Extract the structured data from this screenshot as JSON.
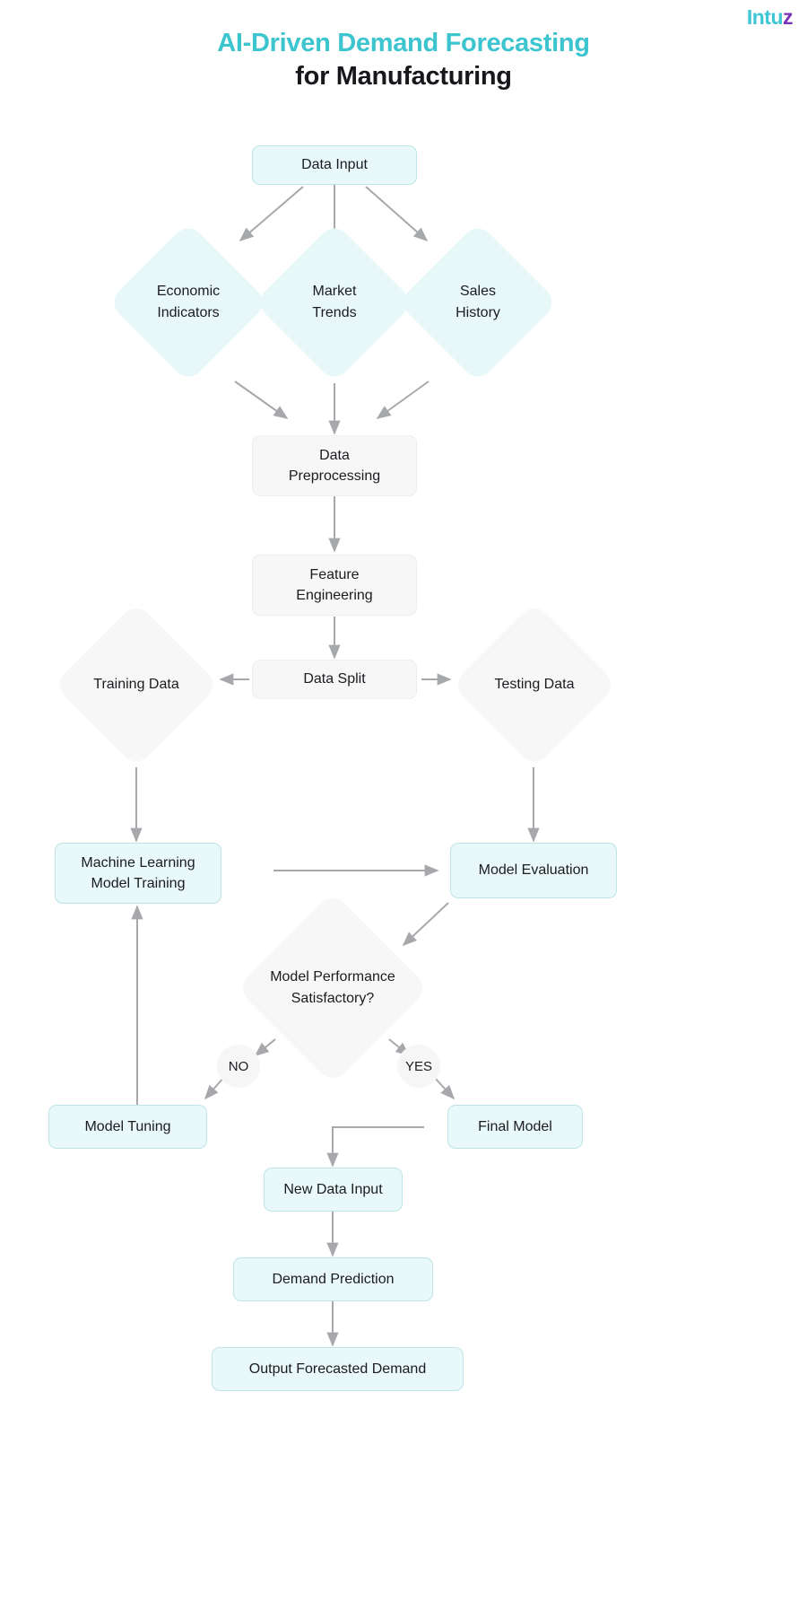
{
  "brand": {
    "name_main": "Intu",
    "name_accent": "z",
    "accent_color": "#3fc6d4",
    "accent_color_2": "#7b2fb5"
  },
  "title": {
    "line1": "AI-Driven Demand Forecasting",
    "line2": "for Manufacturing",
    "line1_color": "#3cc4cf",
    "line2_color": "#17181c"
  },
  "flow": {
    "nodes": {
      "data_input": "Data Input",
      "economic_indicators": "Economic\nIndicators",
      "economic_indicators_l1": "Economic",
      "economic_indicators_l2": "Indicators",
      "market_trends_l1": "Market",
      "market_trends_l2": "Trends",
      "sales_history_l1": "Sales",
      "sales_history_l2": "History",
      "data_preprocessing_l1": "Data",
      "data_preprocessing_l2": "Preprocessing",
      "feature_engineering_l1": "Feature",
      "feature_engineering_l2": "Engineering",
      "training_data": "Training Data",
      "data_split": "Data Split",
      "testing_data": "Testing Data",
      "ml_model_training_l1": "Machine Learning",
      "ml_model_training_l2": "Model Training",
      "model_evaluation": "Model Evaluation",
      "decision_l1": "Model Performance",
      "decision_l2": "Satisfactory?",
      "model_tuning": "Model Tuning",
      "final_model": "Final Model",
      "new_data_input": "New Data Input",
      "demand_prediction": "Demand Prediction",
      "output_forecasted_demand": "Output Forecasted Demand"
    },
    "labels": {
      "no": "NO",
      "yes": "YES"
    },
    "colors": {
      "mint_fill": "#e9f8f8",
      "mint_border": "#bfe4e8",
      "grey_fill": "#f7f7f8",
      "grey_border": "#eeeef0",
      "connector": "#a7a8ac",
      "text": "#1b1c20"
    }
  }
}
